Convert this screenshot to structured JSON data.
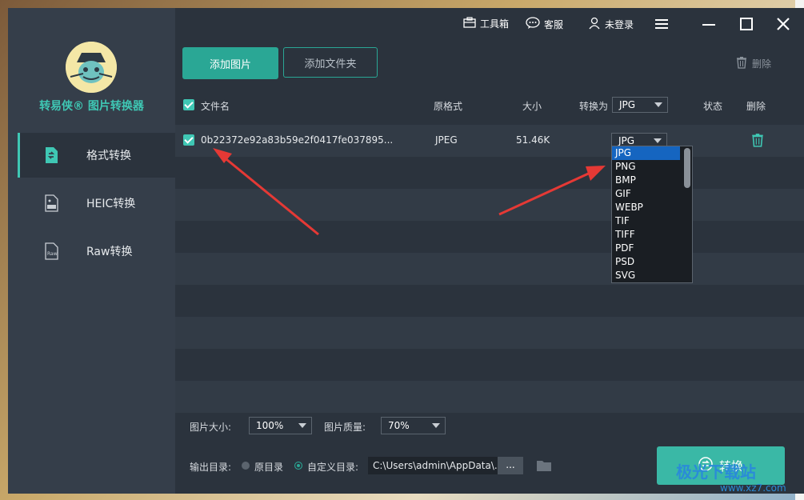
{
  "app": {
    "brand": "转易侠® 图片转换器",
    "brand_color": "#3fc7b4"
  },
  "titlebar": {
    "toolbox": "工具箱",
    "support": "客服",
    "login": "未登录"
  },
  "sidebar": {
    "items": [
      {
        "label": "格式转换",
        "icon": "format-convert-icon",
        "active": true
      },
      {
        "label": "HEIC转换",
        "icon": "heic-icon",
        "active": false
      },
      {
        "label": "Raw转换",
        "icon": "raw-icon",
        "active": false
      }
    ]
  },
  "toolbar": {
    "add_image": "添加图片",
    "add_folder": "添加文件夹",
    "delete": "删除"
  },
  "table": {
    "headers": {
      "filename": "文件名",
      "orig_format": "原格式",
      "size": "大小",
      "convert_to": "转换为",
      "status": "状态",
      "delete": "删除"
    },
    "header_format": "JPG",
    "rows": [
      {
        "filename": "0b22372e92a83b59e2f0417fe037895...",
        "orig_format": "JPEG",
        "size": "51.46K",
        "target": "JPG",
        "status": ""
      }
    ]
  },
  "format_dropdown": {
    "options": [
      "JPG",
      "PNG",
      "BMP",
      "GIF",
      "WEBP",
      "TIF",
      "TIFF",
      "PDF",
      "PSD",
      "SVG"
    ],
    "selected": "JPG"
  },
  "settings": {
    "size_label": "图片大小:",
    "size_value": "100%",
    "quality_label": "图片质量:",
    "quality_value": "70%",
    "output_label": "输出目录:",
    "option_original": "原目录",
    "option_custom": "自定义目录:",
    "output_path": "C:\\Users\\admin\\AppData\\...",
    "browse": "...",
    "convert": "转换"
  },
  "watermark": {
    "text": "极光下载站",
    "url": "www.xz7.com"
  }
}
